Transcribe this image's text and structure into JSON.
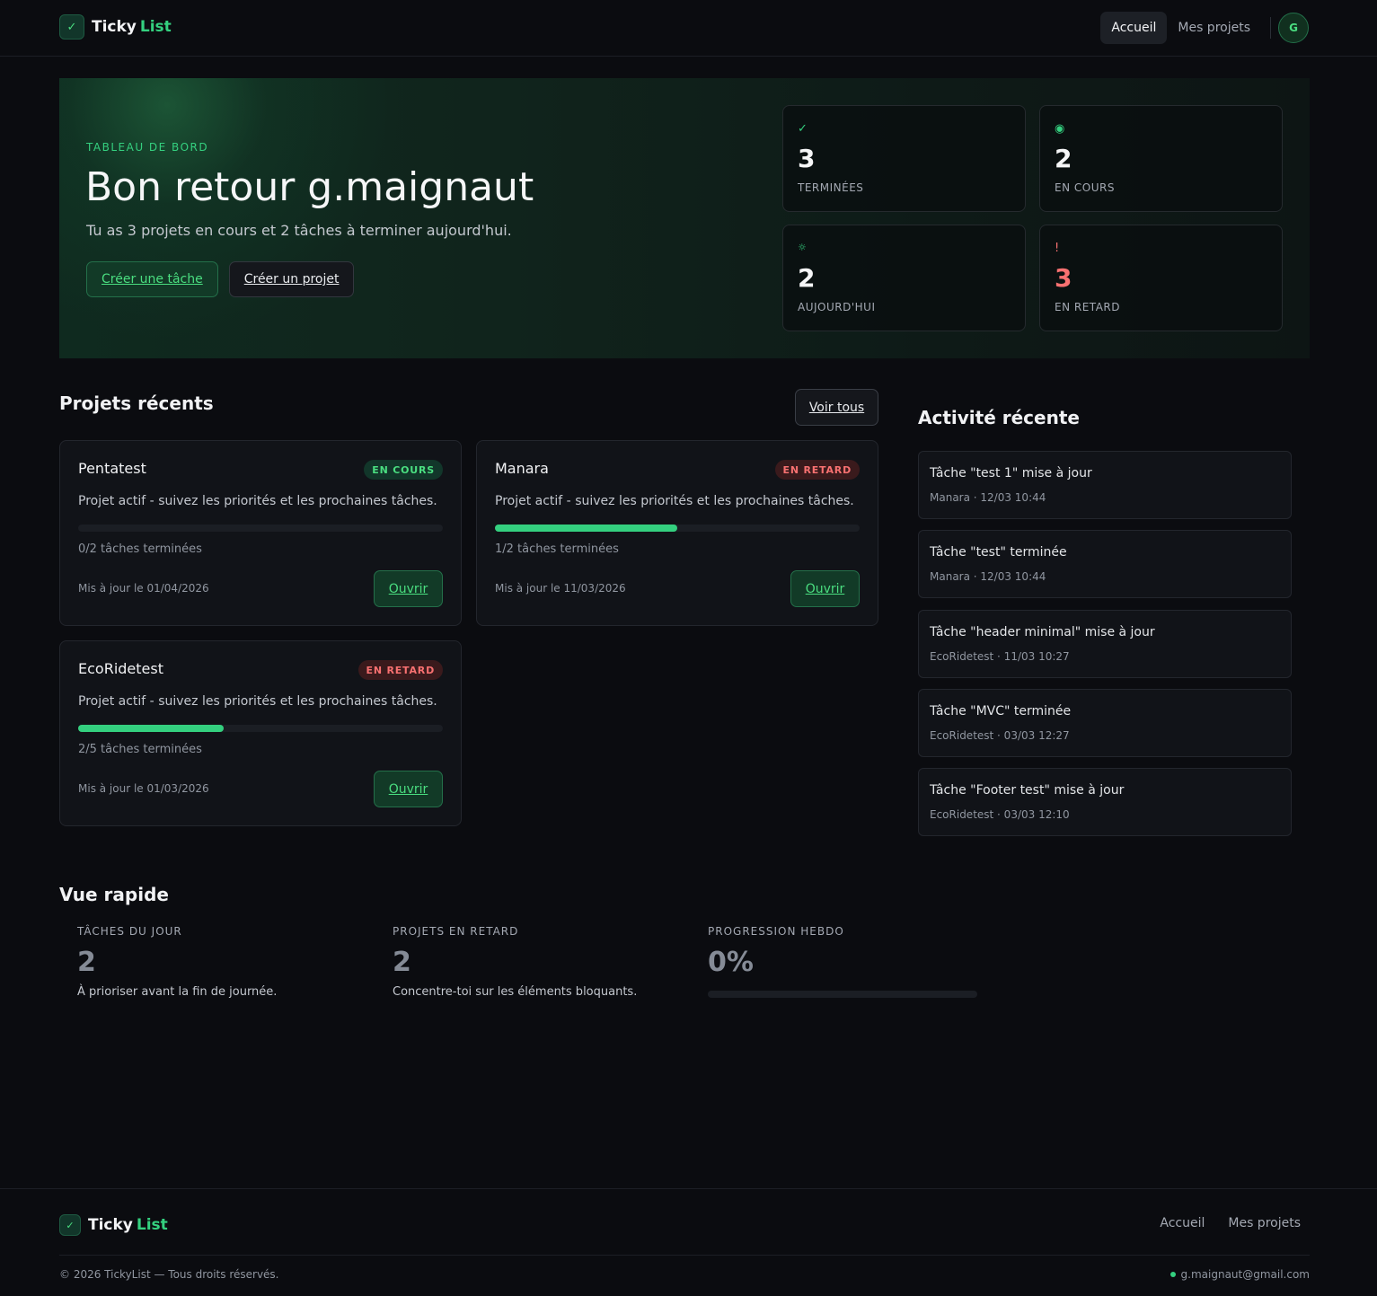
{
  "brand": {
    "name": "Ticky",
    "accent": "List",
    "check_icon": "✓"
  },
  "nav": {
    "home": "Accueil",
    "projects": "Mes projets",
    "avatar_initial": "G"
  },
  "hero": {
    "kicker": "TABLEAU DE BORD",
    "title": "Bon retour g.maignaut",
    "subtitle": "Tu as 3 projets en cours et 2 tâches à terminer aujourd'hui.",
    "create_task": "Créer une tâche",
    "create_project": "Créer un projet"
  },
  "stats": [
    {
      "icon": "✓",
      "value": "3",
      "label": "TERMINÉES",
      "color": "#f5f6f7"
    },
    {
      "icon": "◉",
      "value": "2",
      "label": "EN COURS",
      "color": "#f5f6f7"
    },
    {
      "icon": "☼",
      "value": "2",
      "label": "AUJOURD'HUI",
      "color": "#f5f6f7"
    },
    {
      "icon": "!",
      "value": "3",
      "label": "EN RETARD",
      "color": "#f87171"
    }
  ],
  "projects_section": {
    "title": "Projets récents",
    "see_all": "Voir tous",
    "open_label": "Ouvrir",
    "items": [
      {
        "name": "Pentatest",
        "status": "EN COURS",
        "description": "Projet actif - suivez les priorités et les prochaines tâches.",
        "progress": 0,
        "count": "0/2 tâches terminées",
        "updated": "Mis à jour le 01/04/2026"
      },
      {
        "name": "Manara",
        "status": "EN RETARD",
        "description": "Projet actif - suivez les priorités et les prochaines tâches.",
        "progress": 0.5,
        "count": "1/2 tâches terminées",
        "updated": "Mis à jour le 11/03/2026"
      },
      {
        "name": "EcoRidetest",
        "status": "EN RETARD",
        "description": "Projet actif - suivez les priorités et les prochaines tâches.",
        "progress": 0.4,
        "count": "2/5 tâches terminées",
        "updated": "Mis à jour le 01/03/2026"
      }
    ]
  },
  "activity": {
    "title": "Activité récente",
    "items": [
      {
        "title": "Tâche \"test 1\" mise à jour",
        "meta": "Manara · 12/03 10:44"
      },
      {
        "title": "Tâche \"test\" terminée",
        "meta": "Manara · 12/03 10:44"
      },
      {
        "title": "Tâche \"header minimal\" mise à jour",
        "meta": "EcoRidetest · 11/03 10:27"
      },
      {
        "title": "Tâche \"MVC\" terminée",
        "meta": "EcoRidetest · 03/03 12:27"
      },
      {
        "title": "Tâche \"Footer test\" mise à jour",
        "meta": "EcoRidetest · 03/03 12:10"
      }
    ]
  },
  "quick_view": {
    "title": "Vue rapide",
    "today": {
      "label": "TÂCHES DU JOUR",
      "value": "2",
      "desc": "À prioriser avant la fin de journée."
    },
    "late": {
      "label": "PROJETS EN RETARD",
      "value": "2",
      "desc": "Concentre-toi sur les éléments bloquants."
    },
    "weekly": {
      "label": "PROGRESSION HEBDO",
      "value": "0%",
      "progress": 0
    }
  },
  "footer": {
    "home": "Accueil",
    "projects": "Mes projets",
    "copyright": "© 2026 TickyList — Tous droits réservés.",
    "email": "g.maignaut@gmail.com"
  },
  "colors": {
    "accent": "#34d07f",
    "danger": "#f87171",
    "background": "#0b0c10"
  }
}
